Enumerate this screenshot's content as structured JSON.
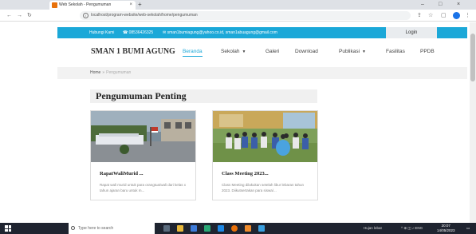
{
  "browser": {
    "tab_title": "Web Sekolah - Pengumuman",
    "tab_close": "×",
    "new_tab": "+",
    "url": "localhost/program-website/web-sekolah/home/pengumuman",
    "win_minimize": "–",
    "win_maximize": "□",
    "win_close": "×",
    "info_glyph": "i"
  },
  "site": {
    "topbar": {
      "contact_label": "Hubungi Kami",
      "phone": "☎ 08536426325",
      "email": "✉ sman1bumiagung@yahoo.co.id, sman1abuagung@gmail.com",
      "login_label": "Login"
    },
    "brand": "SMAN 1 BUMI AGUNG",
    "nav": [
      {
        "label": "Beranda",
        "active": true
      },
      {
        "label": "Sekolah",
        "dropdown": true
      },
      {
        "label": "Galeri"
      },
      {
        "label": "Download"
      },
      {
        "label": "Publikasi",
        "dropdown": true
      },
      {
        "label": "Fasilitas"
      },
      {
        "label": "PPDB"
      }
    ],
    "caret": "▼",
    "breadcrumb": {
      "home": "Home",
      "sep": "»",
      "current": "Pengumuman"
    },
    "section_title": "Pengumuman Penting",
    "announcements": [
      {
        "title": "RapatWaliMurid ...",
        "excerpt": "Rapat wali murid untuk para orangtua/wali dari kelas x tahun ajaran baru untuk m..."
      },
      {
        "title": "Class Meeting 2023...",
        "excerpt": "Class Meeting dilakukan setelah libur lebaran tahun 2023. Diikutsertakan para siswa/..."
      }
    ]
  },
  "taskbar": {
    "search_placeholder": "Type here to search",
    "weather": "Hujan lebat",
    "tray": "^ ⊕ ◫ ♪ ENG",
    "time": "20:07",
    "date": "14/05/2023"
  },
  "colors": {
    "accent": "#1ba8d8",
    "taskbar": "#1f2430"
  },
  "icons": [
    "windows-icon",
    "search-icon",
    "back-icon",
    "forward-icon",
    "reload-icon",
    "info-icon",
    "share-icon",
    "star-icon",
    "tab-search-icon",
    "profile-icon",
    "more-icon"
  ]
}
